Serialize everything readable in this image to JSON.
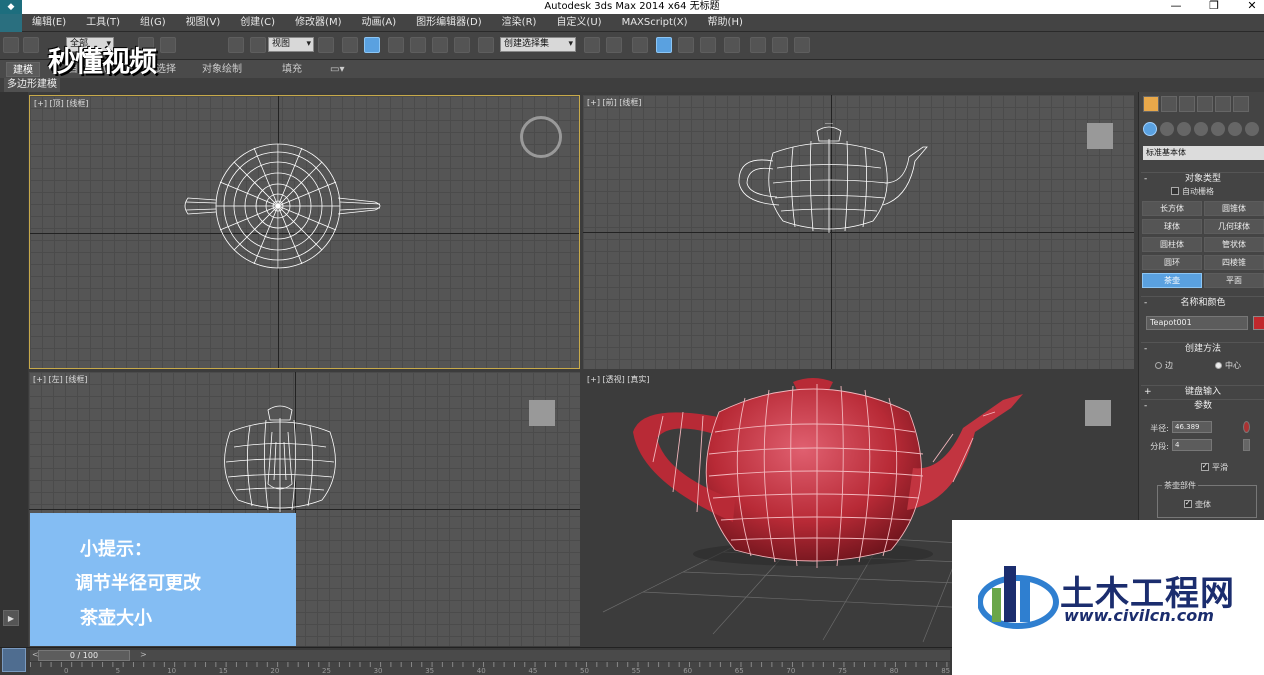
{
  "window": {
    "title": "Autodesk 3ds Max  2014 x64     无标题",
    "controls": [
      "—",
      "❐",
      "✕"
    ]
  },
  "menu": [
    "编辑(E)",
    "工具(T)",
    "组(G)",
    "视图(V)",
    "创建(C)",
    "修改器(M)",
    "动画(A)",
    "图形编辑器(D)",
    "渲染(R)",
    "自定义(U)",
    "MAXScript(X)",
    "帮助(H)"
  ],
  "toolbar": {
    "filter_value": "全部",
    "view_value": "视图",
    "selection_set_placeholder": "创建选择集"
  },
  "ribbon": {
    "tabs": [
      "建模",
      "自由形式",
      "选择",
      "对象绘制",
      "填充"
    ],
    "subtitle": "多边形建模"
  },
  "watermark": {
    "text": "秒懂视频"
  },
  "viewports": {
    "top": {
      "label": "[+] [顶] [线框]"
    },
    "front": {
      "label": "[+] [前] [线框]"
    },
    "left": {
      "label": "[+] [左] [线框]"
    },
    "perspective": {
      "label": "[+] [透视] [真实]"
    }
  },
  "command_panel": {
    "category_dropdown": "标准基本体",
    "object_type_title": "对象类型",
    "auto_grid": "自动栅格",
    "objects": [
      "长方体",
      "圆锥体",
      "球体",
      "几何球体",
      "圆柱体",
      "管状体",
      "圆环",
      "四棱锥",
      "茶壶",
      "平面"
    ],
    "selected_object": "茶壶",
    "name_color_title": "名称和颜色",
    "object_name": "Teapot001",
    "object_color": "#c0282c",
    "creation_method_title": "创建方法",
    "creation_methods": [
      "边",
      "中心"
    ],
    "keyboard_entry_title": "键盘输入",
    "parameters_title": "参数",
    "radius_label": "半径:",
    "radius_value": "46.389",
    "segments_label": "分段:",
    "segments_value": "4",
    "smooth_label": "平滑",
    "teapot_parts_title": "茶壶部件",
    "body_label": "壶体"
  },
  "tip": {
    "line1": "小提示：",
    "line2": "调节半径可更改",
    "line3": "茶壶大小"
  },
  "timeline": {
    "frame": "0 / 100",
    "ticks": [
      "0",
      "5",
      "10",
      "15",
      "20",
      "25",
      "30",
      "35",
      "40",
      "45",
      "50",
      "55",
      "60",
      "65",
      "70",
      "75",
      "80",
      "85",
      "90"
    ]
  },
  "logo": {
    "name": "土木工程网",
    "url": "www.civilcn.com"
  }
}
